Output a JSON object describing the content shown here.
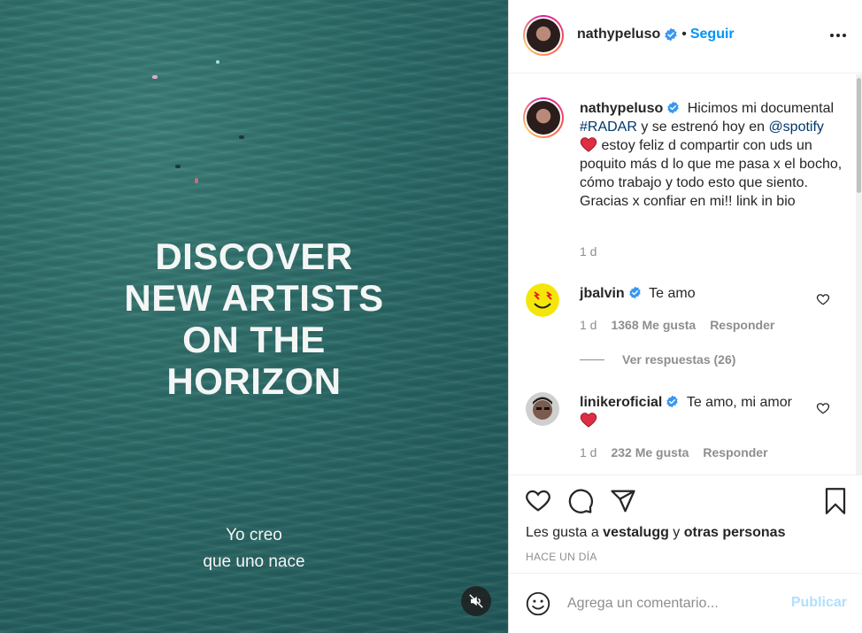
{
  "media": {
    "headline_lines": [
      "DISCOVER",
      "NEW ARTISTS",
      "ON THE",
      "HORIZON"
    ],
    "subtitle_lines": [
      "Yo creo",
      "que uno nace"
    ],
    "mute_icon": "muted-speaker-icon"
  },
  "header": {
    "username": "nathypeluso",
    "separator": "•",
    "follow_label": "Seguir",
    "more_icon": "ellipsis-icon"
  },
  "caption": {
    "username": "nathypeluso",
    "text_1": "Hicimos mi documental ",
    "hashtag": "#RADAR",
    "text_2": " y se estrenó hoy en ",
    "mention": "@spotify",
    "text_3": " estoy feliz d compartir con uds un poquito más d lo que me pasa x el bocho, cómo trabajo y todo esto que siento. Gracias x confiar en mi!! link in bio",
    "time": "1 d"
  },
  "comments": [
    {
      "username": "jbalvin",
      "text": "Te amo",
      "time": "1 d",
      "likes": "1368 Me gusta",
      "reply": "Responder",
      "view_replies": "Ver respuestas (26)"
    },
    {
      "username": "linikeroficial",
      "text": "Te amo, mi amor",
      "time": "1 d",
      "likes": "232 Me gusta",
      "reply": "Responder"
    }
  ],
  "actions": {
    "likes_prefix": "Les gusta a ",
    "likes_user": "vestalugg",
    "likes_mid": " y ",
    "likes_others": "otras personas",
    "time_ago": "HACE UN DÍA"
  },
  "composer": {
    "placeholder": "Agrega un comentario...",
    "publish_label": "Publicar"
  },
  "colors": {
    "accent": "#0095f6",
    "link": "#00376b",
    "muted": "#8e8e8e",
    "heart": "#ed4956"
  }
}
